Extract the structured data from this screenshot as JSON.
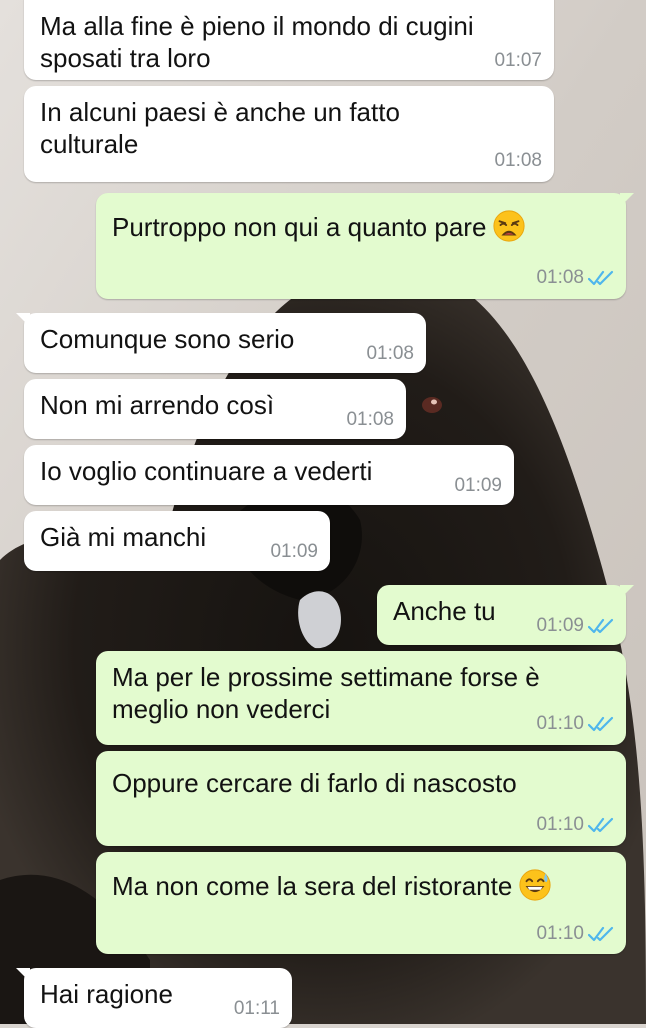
{
  "messages": [
    {
      "dir": "in",
      "text": "Ma alla fine è pieno il mondo di cugini sposati tra loro",
      "lines": [
        "Ma alla fine è pieno il mondo di cugini",
        "sposati tra loro"
      ],
      "time": "01:07"
    },
    {
      "dir": "in",
      "text": "In alcuni paesi è anche un fatto culturale",
      "lines": [
        "In alcuni paesi è anche un fatto",
        "culturale"
      ],
      "time": "01:08"
    },
    {
      "dir": "out",
      "text": "Purtroppo non qui a quanto pare",
      "emoji": "weary-face-emoji",
      "time": "01:08",
      "status": "read"
    },
    {
      "dir": "in",
      "text": "Comunque sono serio",
      "time": "01:08"
    },
    {
      "dir": "in",
      "text": "Non mi arrendo così",
      "time": "01:08"
    },
    {
      "dir": "in",
      "text": "Io voglio continuare a vederti",
      "time": "01:09"
    },
    {
      "dir": "in",
      "text": "Già mi manchi",
      "time": "01:09"
    },
    {
      "dir": "out",
      "text": "Anche tu",
      "time": "01:09",
      "status": "read"
    },
    {
      "dir": "out",
      "text": "Ma per le prossime settimane forse è meglio non vederci",
      "lines": [
        "Ma per le prossime settimane forse è",
        "meglio non vederci"
      ],
      "time": "01:10",
      "status": "read"
    },
    {
      "dir": "out",
      "text": "Oppure cercare di farlo di nascosto",
      "time": "01:10",
      "status": "read"
    },
    {
      "dir": "out",
      "text": "Ma non come la sera del ristorante",
      "emoji": "grinning-sweat-emoji",
      "time": "01:10",
      "status": "read"
    },
    {
      "dir": "in",
      "text": "Hai ragione",
      "time": "01:11"
    }
  ],
  "colors": {
    "incoming_bubble": "#ffffff",
    "outgoing_bubble": "#e3fbcf",
    "read_ticks": "#4fb6ec",
    "timestamp": "#8a8f93"
  }
}
